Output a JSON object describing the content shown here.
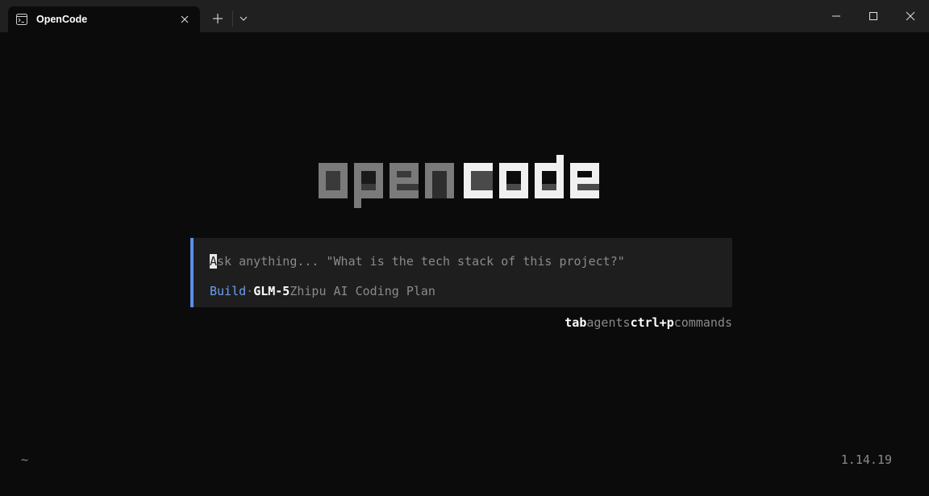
{
  "window": {
    "tab_title": "OpenCode",
    "tab_icon": "terminal-icon",
    "controls": [
      "minimize-icon",
      "maximize-icon",
      "close-icon"
    ]
  },
  "logo": {
    "text_dim": "open",
    "text_bright": "code",
    "colors": {
      "dim": "#7a7a7a",
      "bright": "#f0f0f0",
      "shadow": "#3a3a3a"
    }
  },
  "prompt": {
    "cursor_char": "A",
    "placeholder_rest": "sk anything... \"What is the tech stack of this project?\"",
    "agent": "Build",
    "separator": "·",
    "model": "GLM-5",
    "provider": "Zhipu AI Coding Plan",
    "accent_color": "#5b8ee6"
  },
  "hints": [
    {
      "key": "tab",
      "label": "agents"
    },
    {
      "key": "ctrl+p",
      "label": "commands"
    }
  ],
  "footer": {
    "cwd": "~",
    "version": "1.14.19"
  }
}
